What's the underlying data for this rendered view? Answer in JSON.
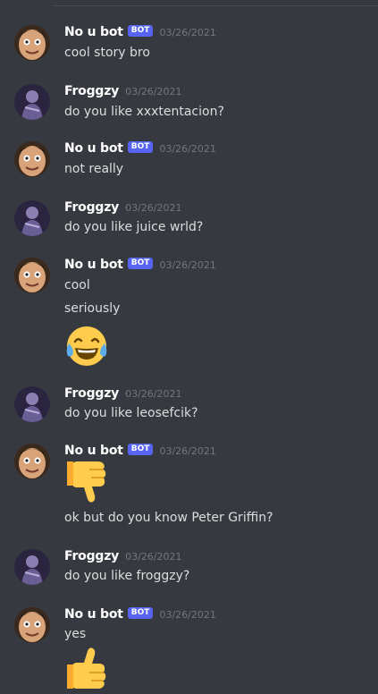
{
  "messages": [
    {
      "user": "No u bot",
      "bot": "BOT",
      "timestamp": "03/26/2021",
      "lines": [
        "cool story bro"
      ]
    },
    {
      "user": "Froggzy",
      "timestamp": "03/26/2021",
      "lines": [
        "do you like xxxtentacion?"
      ]
    },
    {
      "user": "No u bot",
      "bot": "BOT",
      "timestamp": "03/26/2021",
      "lines": [
        "not really"
      ]
    },
    {
      "user": "Froggzy",
      "timestamp": "03/26/2021",
      "lines": [
        "do you like juice wrld?"
      ]
    },
    {
      "user": "No u bot",
      "bot": "BOT",
      "timestamp": "03/26/2021",
      "lines": [
        "cool",
        "seriously"
      ],
      "emoji": "joy-emoji"
    },
    {
      "user": "Froggzy",
      "timestamp": "03/26/2021",
      "lines": [
        "do you like leosefcik?"
      ]
    },
    {
      "user": "No u bot",
      "bot": "BOT",
      "timestamp": "03/26/2021",
      "emoji": "thumbs-down-emoji",
      "lines": [
        "ok but do you know Peter Griffin?"
      ]
    },
    {
      "user": "Froggzy",
      "timestamp": "03/26/2021",
      "lines": [
        "do you like froggzy?"
      ]
    },
    {
      "user": "No u bot",
      "bot": "BOT",
      "timestamp": "03/26/2021",
      "lines": [
        "yes"
      ],
      "emoji": "thumbs-up-emoji"
    }
  ],
  "colors": {
    "background": "#36393f",
    "bot_badge": "#5865f2",
    "username": "#ffffff",
    "timestamp": "#72767d",
    "text": "#dcddde"
  }
}
